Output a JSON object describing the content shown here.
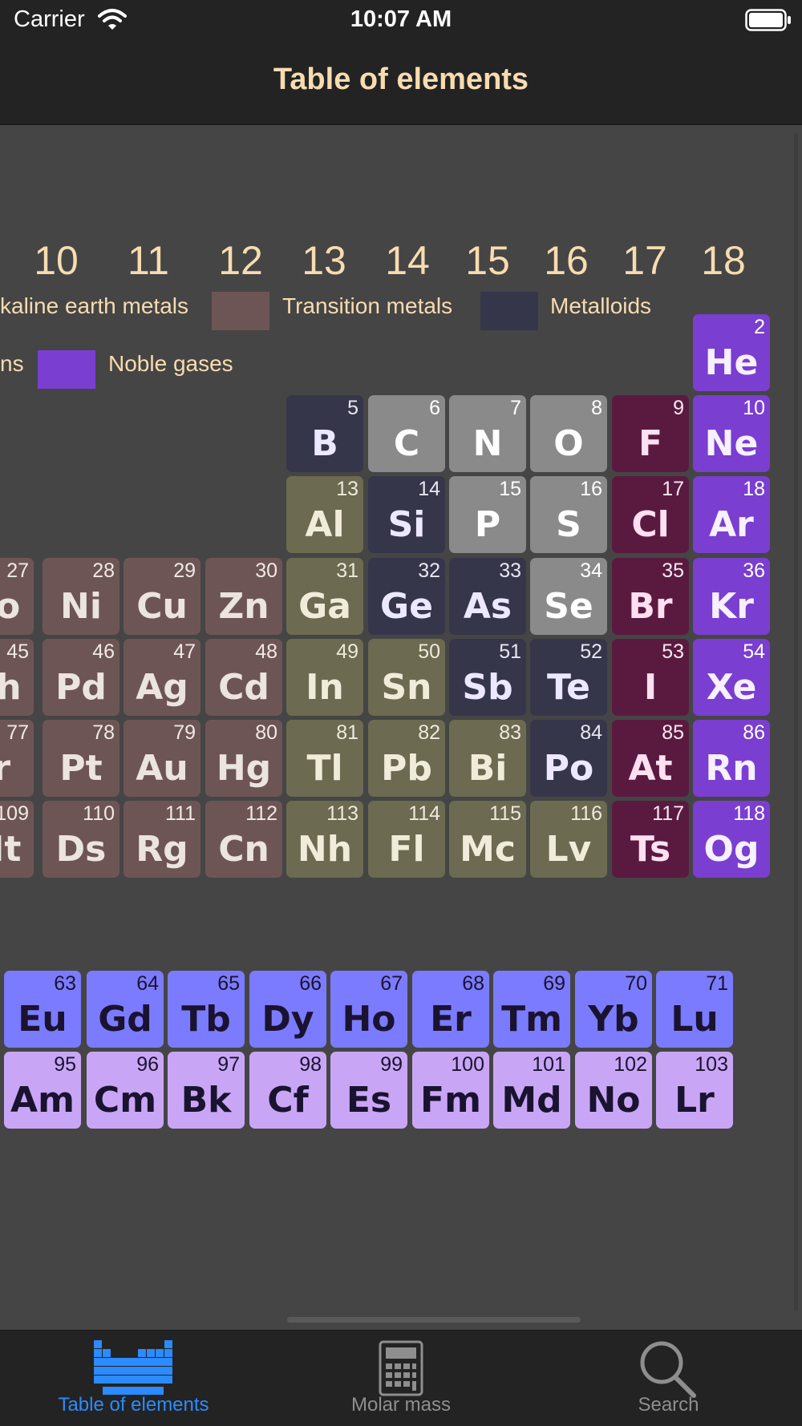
{
  "status_bar": {
    "carrier": "Carrier",
    "time": "10:07 AM"
  },
  "nav": {
    "title": "Table of elements"
  },
  "group_numbers": [
    "10",
    "11",
    "12",
    "13",
    "14",
    "15",
    "16",
    "17",
    "18"
  ],
  "legend": {
    "alkaline_earth_label": "kaline earth metals",
    "transition_label": "Transition metals",
    "metalloids_label": "Metalloids",
    "halogens_partial_label": "ns",
    "noble_label": "Noble gases"
  },
  "colors": {
    "background": "#454545",
    "bar": "#232323",
    "title": "#f7dcb0",
    "transition": "#6e5555",
    "metalloid": "#35364a",
    "post_transition": "#6c6a50",
    "nonmetal": "#8a8a8a",
    "halogen": "#5a1a40",
    "noble": "#7a3ed0",
    "lanthanide": "#7b7bff",
    "actinide": "#c9a6f5",
    "tab_active": "#2b8bff",
    "tab_inactive": "#8e8e8e"
  },
  "elements": [
    {
      "s": "He",
      "n": "2",
      "c": "noble"
    },
    {
      "s": "B",
      "n": "5",
      "c": "metalloid"
    },
    {
      "s": "C",
      "n": "6",
      "c": "nonmetal"
    },
    {
      "s": "N",
      "n": "7",
      "c": "nonmetal"
    },
    {
      "s": "O",
      "n": "8",
      "c": "nonmetal"
    },
    {
      "s": "F",
      "n": "9",
      "c": "halogen"
    },
    {
      "s": "Ne",
      "n": "10",
      "c": "noble"
    },
    {
      "s": "Al",
      "n": "13",
      "c": "post_transition"
    },
    {
      "s": "Si",
      "n": "14",
      "c": "metalloid"
    },
    {
      "s": "P",
      "n": "15",
      "c": "nonmetal"
    },
    {
      "s": "S",
      "n": "16",
      "c": "nonmetal"
    },
    {
      "s": "Cl",
      "n": "17",
      "c": "halogen"
    },
    {
      "s": "Ar",
      "n": "18",
      "c": "noble"
    },
    {
      "s": "Co",
      "n": "27",
      "c": "transition"
    },
    {
      "s": "Ni",
      "n": "28",
      "c": "transition"
    },
    {
      "s": "Cu",
      "n": "29",
      "c": "transition"
    },
    {
      "s": "Zn",
      "n": "30",
      "c": "transition"
    },
    {
      "s": "Ga",
      "n": "31",
      "c": "post_transition"
    },
    {
      "s": "Ge",
      "n": "32",
      "c": "metalloid"
    },
    {
      "s": "As",
      "n": "33",
      "c": "metalloid"
    },
    {
      "s": "Se",
      "n": "34",
      "c": "nonmetal"
    },
    {
      "s": "Br",
      "n": "35",
      "c": "halogen"
    },
    {
      "s": "Kr",
      "n": "36",
      "c": "noble"
    },
    {
      "s": "Rh",
      "n": "45",
      "c": "transition"
    },
    {
      "s": "Pd",
      "n": "46",
      "c": "transition"
    },
    {
      "s": "Ag",
      "n": "47",
      "c": "transition"
    },
    {
      "s": "Cd",
      "n": "48",
      "c": "transition"
    },
    {
      "s": "In",
      "n": "49",
      "c": "post_transition"
    },
    {
      "s": "Sn",
      "n": "50",
      "c": "post_transition"
    },
    {
      "s": "Sb",
      "n": "51",
      "c": "metalloid"
    },
    {
      "s": "Te",
      "n": "52",
      "c": "metalloid"
    },
    {
      "s": "I",
      "n": "53",
      "c": "halogen"
    },
    {
      "s": "Xe",
      "n": "54",
      "c": "noble"
    },
    {
      "s": "Ir",
      "n": "77",
      "c": "transition"
    },
    {
      "s": "Pt",
      "n": "78",
      "c": "transition"
    },
    {
      "s": "Au",
      "n": "79",
      "c": "transition"
    },
    {
      "s": "Hg",
      "n": "80",
      "c": "transition"
    },
    {
      "s": "Tl",
      "n": "81",
      "c": "post_transition"
    },
    {
      "s": "Pb",
      "n": "82",
      "c": "post_transition"
    },
    {
      "s": "Bi",
      "n": "83",
      "c": "post_transition"
    },
    {
      "s": "Po",
      "n": "84",
      "c": "metalloid"
    },
    {
      "s": "At",
      "n": "85",
      "c": "halogen"
    },
    {
      "s": "Rn",
      "n": "86",
      "c": "noble"
    },
    {
      "s": "Mt",
      "n": "109",
      "c": "transition"
    },
    {
      "s": "Ds",
      "n": "110",
      "c": "transition"
    },
    {
      "s": "Rg",
      "n": "111",
      "c": "transition"
    },
    {
      "s": "Cn",
      "n": "112",
      "c": "transition"
    },
    {
      "s": "Nh",
      "n": "113",
      "c": "post_transition"
    },
    {
      "s": "Fl",
      "n": "114",
      "c": "post_transition"
    },
    {
      "s": "Mc",
      "n": "115",
      "c": "post_transition"
    },
    {
      "s": "Lv",
      "n": "116",
      "c": "post_transition"
    },
    {
      "s": "Ts",
      "n": "117",
      "c": "halogen"
    },
    {
      "s": "Og",
      "n": "118",
      "c": "noble"
    },
    {
      "s": "Eu",
      "n": "63",
      "c": "lanthanide"
    },
    {
      "s": "Gd",
      "n": "64",
      "c": "lanthanide"
    },
    {
      "s": "Tb",
      "n": "65",
      "c": "lanthanide"
    },
    {
      "s": "Dy",
      "n": "66",
      "c": "lanthanide"
    },
    {
      "s": "Ho",
      "n": "67",
      "c": "lanthanide"
    },
    {
      "s": "Er",
      "n": "68",
      "c": "lanthanide"
    },
    {
      "s": "Tm",
      "n": "69",
      "c": "lanthanide"
    },
    {
      "s": "Yb",
      "n": "70",
      "c": "lanthanide"
    },
    {
      "s": "Lu",
      "n": "71",
      "c": "lanthanide"
    },
    {
      "s": "Am",
      "n": "95",
      "c": "actinide"
    },
    {
      "s": "Cm",
      "n": "96",
      "c": "actinide"
    },
    {
      "s": "Bk",
      "n": "97",
      "c": "actinide"
    },
    {
      "s": "Cf",
      "n": "98",
      "c": "actinide"
    },
    {
      "s": "Es",
      "n": "99",
      "c": "actinide"
    },
    {
      "s": "Fm",
      "n": "100",
      "c": "actinide"
    },
    {
      "s": "Md",
      "n": "101",
      "c": "actinide"
    },
    {
      "s": "No",
      "n": "102",
      "c": "actinide"
    },
    {
      "s": "Lr",
      "n": "103",
      "c": "actinide"
    }
  ],
  "tabs": [
    {
      "label": "Table of elements",
      "icon": "periodic-table-icon",
      "active": true
    },
    {
      "label": "Molar mass",
      "icon": "calculator-icon",
      "active": false
    },
    {
      "label": "Search",
      "icon": "magnifier-icon",
      "active": false
    }
  ]
}
